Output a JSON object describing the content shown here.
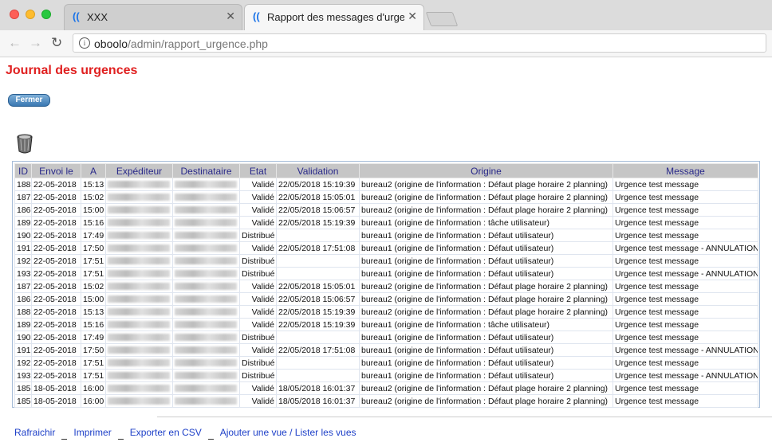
{
  "browser": {
    "tabs": [
      {
        "title": "XXX",
        "active": false
      },
      {
        "title": "Rapport des messages d'urgence",
        "active": true
      }
    ],
    "url_host": "oboolo",
    "url_path": "/admin/rapport_urgence.php"
  },
  "page": {
    "title": "Journal des urgences",
    "close_label": "Fermer"
  },
  "table": {
    "columns": [
      "ID",
      "Envoi le",
      "A",
      "Expéditeur",
      "Destinataire",
      "Etat",
      "Validation",
      "Origine",
      "Message"
    ],
    "rows": [
      {
        "id": "188",
        "date": "22-05-2018",
        "time": "15:13",
        "state": "Validé",
        "validation": "22/05/2018 15:19:39",
        "origin": "bureau2 (origine de l'information : Défaut plage horaire 2 planning)",
        "message": "Urgence test message"
      },
      {
        "id": "187",
        "date": "22-05-2018",
        "time": "15:02",
        "state": "Validé",
        "validation": "22/05/2018 15:05:01",
        "origin": "bureau2 (origine de l'information : Défaut plage horaire 2 planning)",
        "message": "Urgence test message"
      },
      {
        "id": "186",
        "date": "22-05-2018",
        "time": "15:00",
        "state": "Validé",
        "validation": "22/05/2018 15:06:57",
        "origin": "bureau2 (origine de l'information : Défaut plage horaire 2 planning)",
        "message": "Urgence test message"
      },
      {
        "id": "189",
        "date": "22-05-2018",
        "time": "15:16",
        "state": "Validé",
        "validation": "22/05/2018 15:19:39",
        "origin": "bureau1 (origine de l'information : tâche utilisateur)",
        "message": "Urgence test message"
      },
      {
        "id": "190",
        "date": "22-05-2018",
        "time": "17:49",
        "state": "Distribué",
        "validation": "",
        "origin": "bureau1 (origine de l'information : Défaut utilisateur)",
        "message": "Urgence test message"
      },
      {
        "id": "191",
        "date": "22-05-2018",
        "time": "17:50",
        "state": "Validé",
        "validation": "22/05/2018 17:51:08",
        "origin": "bureau1 (origine de l'information : Défaut utilisateur)",
        "message": "Urgence test message - ANNULATION"
      },
      {
        "id": "192",
        "date": "22-05-2018",
        "time": "17:51",
        "state": "Distribué",
        "validation": "",
        "origin": "bureau1 (origine de l'information : Défaut utilisateur)",
        "message": "Urgence test message"
      },
      {
        "id": "193",
        "date": "22-05-2018",
        "time": "17:51",
        "state": "Distribué",
        "validation": "",
        "origin": "bureau1 (origine de l'information : Défaut utilisateur)",
        "message": "Urgence test message - ANNULATION"
      },
      {
        "id": "187",
        "date": "22-05-2018",
        "time": "15:02",
        "state": "Validé",
        "validation": "22/05/2018 15:05:01",
        "origin": "bureau2 (origine de l'information : Défaut plage horaire 2 planning)",
        "message": "Urgence test message"
      },
      {
        "id": "186",
        "date": "22-05-2018",
        "time": "15:00",
        "state": "Validé",
        "validation": "22/05/2018 15:06:57",
        "origin": "bureau2 (origine de l'information : Défaut plage horaire 2 planning)",
        "message": "Urgence test message"
      },
      {
        "id": "188",
        "date": "22-05-2018",
        "time": "15:13",
        "state": "Validé",
        "validation": "22/05/2018 15:19:39",
        "origin": "bureau2 (origine de l'information : Défaut plage horaire 2 planning)",
        "message": "Urgence test message"
      },
      {
        "id": "189",
        "date": "22-05-2018",
        "time": "15:16",
        "state": "Validé",
        "validation": "22/05/2018 15:19:39",
        "origin": "bureau1 (origine de l'information : tâche utilisateur)",
        "message": "Urgence test message"
      },
      {
        "id": "190",
        "date": "22-05-2018",
        "time": "17:49",
        "state": "Distribué",
        "validation": "",
        "origin": "bureau1 (origine de l'information : Défaut utilisateur)",
        "message": "Urgence test message"
      },
      {
        "id": "191",
        "date": "22-05-2018",
        "time": "17:50",
        "state": "Validé",
        "validation": "22/05/2018 17:51:08",
        "origin": "bureau1 (origine de l'information : Défaut utilisateur)",
        "message": "Urgence test message - ANNULATION"
      },
      {
        "id": "192",
        "date": "22-05-2018",
        "time": "17:51",
        "state": "Distribué",
        "validation": "",
        "origin": "bureau1 (origine de l'information : Défaut utilisateur)",
        "message": "Urgence test message"
      },
      {
        "id": "193",
        "date": "22-05-2018",
        "time": "17:51",
        "state": "Distribué",
        "validation": "",
        "origin": "bureau1 (origine de l'information : Défaut utilisateur)",
        "message": "Urgence test message - ANNULATION"
      },
      {
        "id": "185",
        "date": "18-05-2018",
        "time": "16:00",
        "state": "Validé",
        "validation": "18/05/2018 16:01:37",
        "origin": "bureau2 (origine de l'information : Défaut plage horaire 2 planning)",
        "message": "Urgence test message"
      },
      {
        "id": "185",
        "date": "18-05-2018",
        "time": "16:00",
        "state": "Validé",
        "validation": "18/05/2018 16:01:37",
        "origin": "bureau2 (origine de l'information : Défaut plage horaire 2 planning)",
        "message": "Urgence test message"
      }
    ]
  },
  "footer": {
    "links": [
      "Rafraichir",
      "Imprimer",
      "Exporter en CSV",
      "Ajouter une vue / Lister les vues"
    ]
  },
  "colors": {
    "title_red": "#e02020",
    "link_blue": "#1e40c8",
    "header_text": "#2a2a8a"
  }
}
